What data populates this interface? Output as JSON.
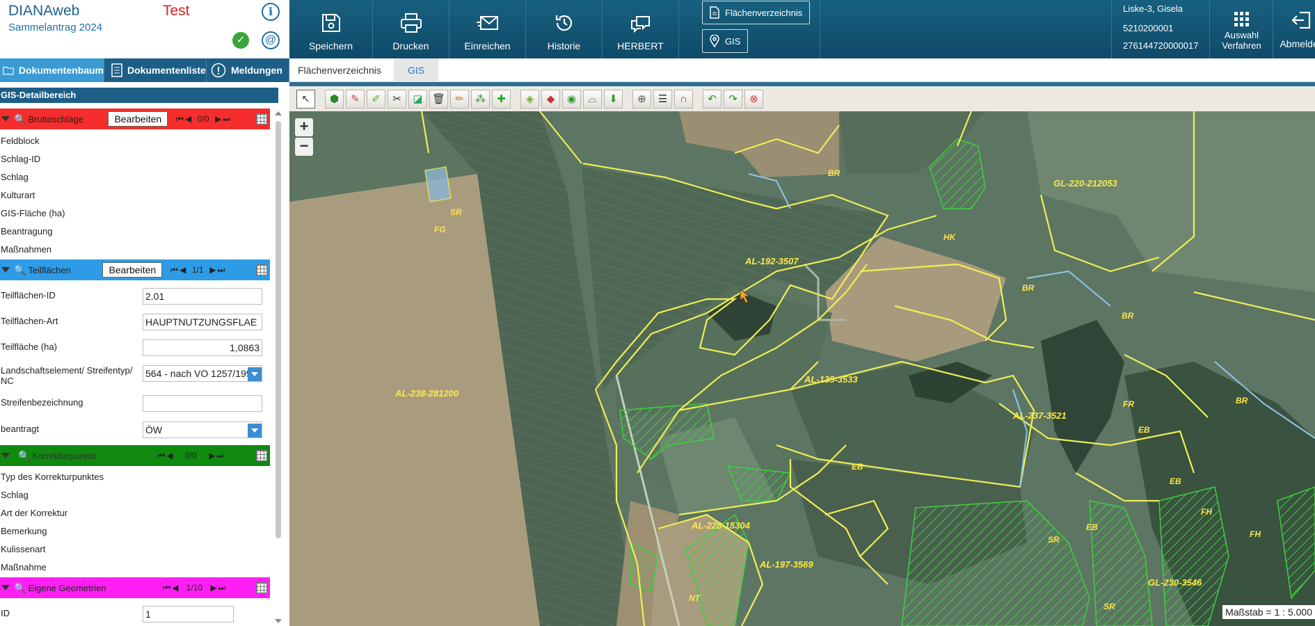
{
  "brand": {
    "app_name": "DIANAweb",
    "environment": "Test",
    "subtitle": "Sammelantrag 2024",
    "info_glyph": "i",
    "ok_glyph": "✓",
    "mail_glyph": "@"
  },
  "left_tabs": [
    {
      "label": "Dokumentenbaum",
      "icon": "folder-icon"
    },
    {
      "label": "Dokumentenliste",
      "icon": "document-list-icon"
    },
    {
      "label": "Meldungen",
      "icon": "alert-circle-icon"
    }
  ],
  "gis_header": "GIS-Detailbereich",
  "sections": {
    "bruttoschlaege": {
      "title": "Bruttoschläge",
      "color": "#f52d2d",
      "button": "Bearbeiten",
      "counter": "0/0",
      "fields": [
        "Feldblock",
        "Schlag-ID",
        "Schlag",
        "Kulturart",
        "GIS-Fläche (ha)",
        "Beantragung",
        "Maßnahmen"
      ]
    },
    "teilflaechen": {
      "title": "Teilflächen",
      "color": "#2d9be6",
      "button": "Bearbeiten",
      "counter": "1/1",
      "fields": [
        {
          "label": "Teilflächen-ID",
          "value": "2.01"
        },
        {
          "label": "Teilflächen-Art",
          "value": "HAUPTNUTZUNGSFLAE"
        },
        {
          "label": "Teilfläche (ha)",
          "value": "1,0863"
        },
        {
          "label": "Landschaftselement/ Streifentyp/ NC",
          "value": "564 - nach VO 1257/199"
        },
        {
          "label": "Streifenbezeichnung",
          "value": ""
        },
        {
          "label": "beantragt",
          "value": "ÖW"
        }
      ]
    },
    "korrekturpunkte": {
      "title": "Korrekturpunkte",
      "color": "#0f8a0f",
      "counter": "0/0",
      "fields": [
        "Typ des Korrekturpunktes",
        "Schlag",
        "Art der Korrektur",
        "Bemerkung",
        "Kulissenart",
        "Maßnahme"
      ]
    },
    "eigene_geometrien": {
      "title": "Eigene Geometrien",
      "color": "#ff1ff5",
      "counter": "1/10",
      "fields": [
        {
          "label": "ID",
          "value": "1"
        }
      ]
    }
  },
  "toolbar": {
    "speichern": "Speichern",
    "drucken": "Drucken",
    "einreichen": "Einreichen",
    "historie": "Historie",
    "herbert": "HERBERT",
    "flaechenverzeichnis": "Flächenverzeichnis",
    "gis": "GIS",
    "user_name": "Liske-3, Gisela",
    "user_id1": "5210200001",
    "user_id2": "276144720000017",
    "auswahl_line1": "Auswahl",
    "auswahl_line2": "Verfahren",
    "abmelden": "Abmelden"
  },
  "main_tabs": [
    {
      "label": "Flächenverzeichnis",
      "active": false
    },
    {
      "label": "GIS",
      "active": true
    }
  ],
  "gis_tools": [
    "select-arrow-icon",
    "add-polygon-icon",
    "edit-polygon-icon",
    "edit-line-icon",
    "cut-icon",
    "split-icon",
    "delete-icon",
    "pencil-icon",
    "merge-icon",
    "add-point-icon",
    "layer-1-icon",
    "layer-2-icon",
    "layer-3-icon",
    "layer-4-icon",
    "layer-5-icon",
    "measure-icon",
    "list-icon",
    "magnet-icon",
    "undo-icon",
    "redo-icon",
    "cancel-icon"
  ],
  "map": {
    "zoom_in": "+",
    "zoom_out": "−",
    "scale_text": "Maßstab = 1 : 5.000",
    "labels": [
      {
        "text": "AL-192-3507"
      },
      {
        "text": "AL-238-281200"
      },
      {
        "text": "AL-135-3533"
      },
      {
        "text": "AL-237-3521"
      },
      {
        "text": "AL-228-15304"
      },
      {
        "text": "AL-197-3569"
      },
      {
        "text": "GL-220-212053"
      },
      {
        "text": "GL-230-3546"
      },
      {
        "text": "HK"
      },
      {
        "text": "BR"
      },
      {
        "text": "FG"
      },
      {
        "text": "SR"
      },
      {
        "text": "FR"
      },
      {
        "text": "EB"
      },
      {
        "text": "FH"
      },
      {
        "text": "NT"
      }
    ],
    "colors": {
      "parcel_outline": "#f0ee55",
      "hatch": "#3dd13d"
    }
  }
}
